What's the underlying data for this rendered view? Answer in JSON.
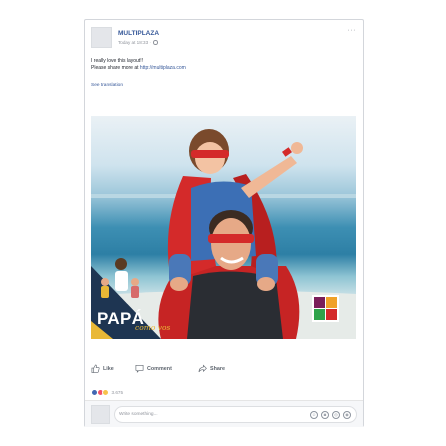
{
  "post": {
    "page_name": "MULTIPLAZA",
    "timestamp": "Today at 18:33 · ",
    "more_icon": "···",
    "line1": "I really love this layout!!",
    "line2_prefix": "Please share more at ",
    "line2_link": "http://multiplaza.com",
    "see_translation": "See translation"
  },
  "photo": {
    "campaign_text": "PAPÁ",
    "campaign_script": "como vos",
    "logo_text": "MULTI PLAZA",
    "colors": {
      "sky": "#eaf1f5",
      "sea": "#2d7fa5",
      "cape": "#d42a2a",
      "navy": "#1e3552",
      "gold": "#e9b836"
    }
  },
  "actions": {
    "like_label": "Like",
    "comment_label": "Comment",
    "share_label": "Share",
    "icons": [
      "thumbs-up-icon",
      "comment-bubble-icon",
      "share-arrow-icon"
    ]
  },
  "reactions": {
    "count": "3.675",
    "types": [
      {
        "name": "like",
        "color": "#4267b2"
      },
      {
        "name": "love",
        "color": "#f25268"
      },
      {
        "name": "haha",
        "color": "#f7c34b"
      }
    ]
  },
  "comment": {
    "placeholder": "Write something...",
    "icons": [
      "emoji-icon",
      "camera-icon",
      "gif-icon",
      "sticker-icon"
    ]
  }
}
